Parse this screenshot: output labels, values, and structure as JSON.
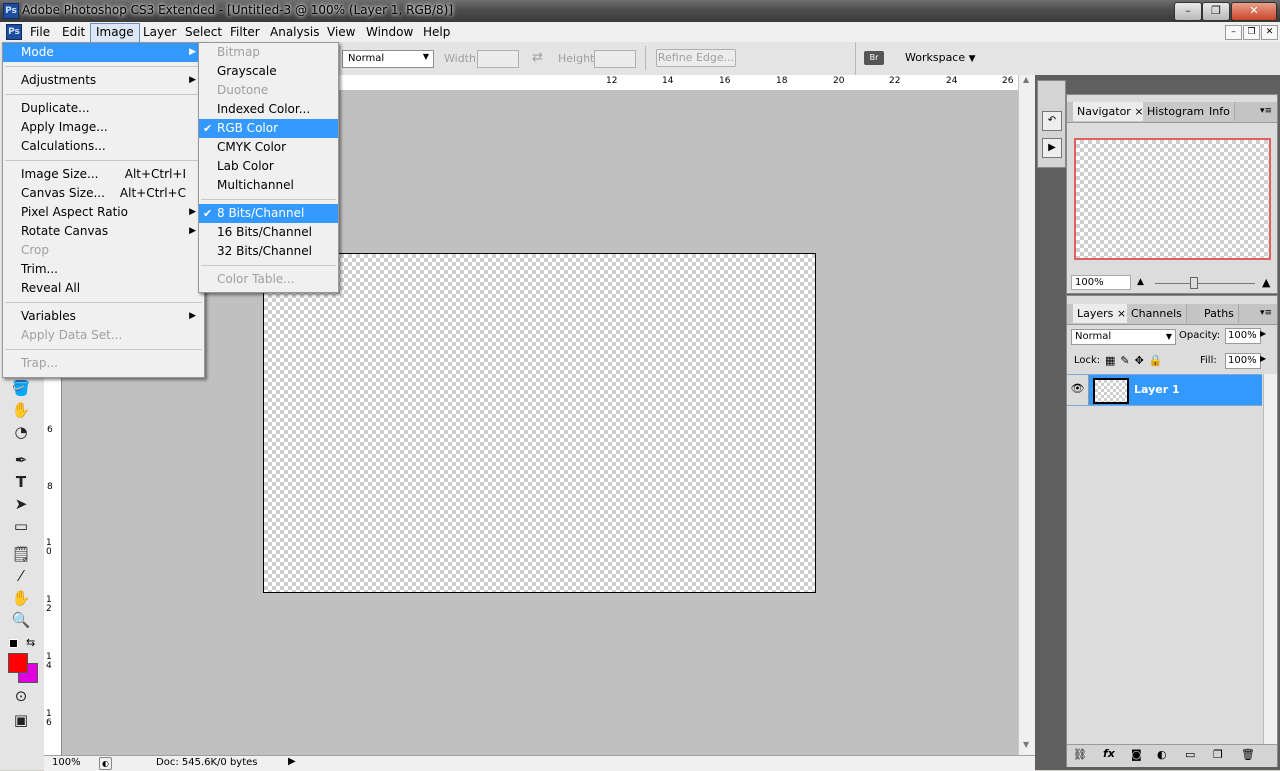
{
  "app": {
    "title": "Adobe Photoshop CS3 Extended - [Untitled-3 @ 100% (Layer 1, RGB/8)]",
    "logo": "Ps"
  },
  "menubar": {
    "items": [
      "File",
      "Edit",
      "Image",
      "Layer",
      "Select",
      "Filter",
      "Analysis",
      "View",
      "Window",
      "Help"
    ],
    "active": "Image"
  },
  "optionsbar": {
    "style_value": "Normal",
    "width_label": "Width:",
    "height_label": "Height:",
    "refine_edge": "Refine Edge...",
    "workspace": "Workspace"
  },
  "image_menu": {
    "items": [
      {
        "label": "Mode",
        "submenu": true,
        "highlight": true
      },
      {
        "sep": true
      },
      {
        "label": "Adjustments",
        "submenu": true
      },
      {
        "sep": true
      },
      {
        "label": "Duplicate..."
      },
      {
        "label": "Apply Image..."
      },
      {
        "label": "Calculations..."
      },
      {
        "sep": true
      },
      {
        "label": "Image Size...",
        "shortcut": "Alt+Ctrl+I"
      },
      {
        "label": "Canvas Size...",
        "shortcut": "Alt+Ctrl+C"
      },
      {
        "label": "Pixel Aspect Ratio",
        "submenu": true
      },
      {
        "label": "Rotate Canvas",
        "submenu": true
      },
      {
        "label": "Crop",
        "disabled": true
      },
      {
        "label": "Trim..."
      },
      {
        "label": "Reveal All"
      },
      {
        "sep": true
      },
      {
        "label": "Variables",
        "submenu": true
      },
      {
        "label": "Apply Data Set...",
        "disabled": true
      },
      {
        "sep": true
      },
      {
        "label": "Trap...",
        "disabled": true
      }
    ]
  },
  "mode_submenu": {
    "items": [
      {
        "label": "Bitmap",
        "disabled": true
      },
      {
        "label": "Grayscale"
      },
      {
        "label": "Duotone",
        "disabled": true
      },
      {
        "label": "Indexed Color..."
      },
      {
        "label": "RGB Color",
        "checked": true,
        "highlight": true
      },
      {
        "label": "CMYK Color"
      },
      {
        "label": "Lab Color"
      },
      {
        "label": "Multichannel"
      },
      {
        "sep": true
      },
      {
        "label": "8 Bits/Channel",
        "checked": true,
        "highlight": true
      },
      {
        "label": "16 Bits/Channel"
      },
      {
        "label": "32 Bits/Channel"
      },
      {
        "sep": true
      },
      {
        "label": "Color Table...",
        "disabled": true
      }
    ]
  },
  "rulers": {
    "top": [
      "12",
      "14",
      "16",
      "18",
      "20",
      "22",
      "24",
      "26"
    ],
    "left": [
      "6",
      "8",
      "1 0",
      "1 2",
      "1 4",
      "1 6"
    ]
  },
  "statusbar": {
    "zoom": "100%",
    "doc": "Doc: 545.6K/0 bytes"
  },
  "navigator": {
    "tabs": [
      "Navigator",
      "Histogram",
      "Info"
    ],
    "zoom": "100%"
  },
  "layers_panel": {
    "tabs": [
      "Layers",
      "Channels",
      "Paths"
    ],
    "blend_mode": "Normal",
    "opacity_label": "Opacity:",
    "opacity": "100%",
    "lock_label": "Lock:",
    "fill_label": "Fill:",
    "fill": "100%",
    "layers": [
      {
        "name": "Layer 1",
        "selected": true
      }
    ]
  },
  "colors": {
    "foreground": "#ff0000",
    "background": "#e000e0",
    "highlight": "#3399ff"
  }
}
